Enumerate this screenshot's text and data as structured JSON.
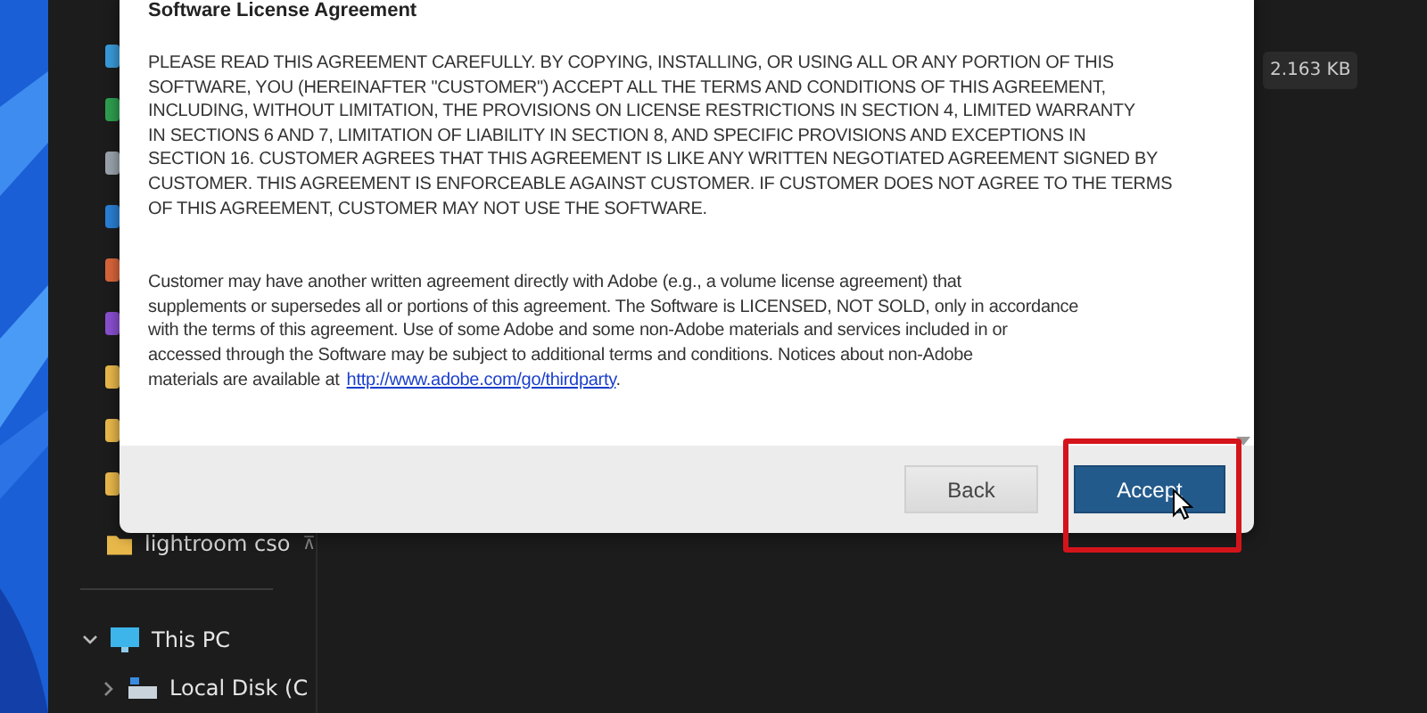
{
  "explorer": {
    "hidden_items": [
      {
        "color": "#3a9ad9"
      },
      {
        "color": "#2e9e4f"
      },
      {
        "color": "#9aa3ad"
      },
      {
        "color": "#2a7fd4"
      },
      {
        "color": "#d9653b"
      },
      {
        "color": "#8a4fd0"
      },
      {
        "color": "#e8b84a"
      },
      {
        "color": "#e8b84a"
      },
      {
        "color": "#e8b84a"
      }
    ],
    "folder": {
      "label": "lightroom cso",
      "pin": "⊼"
    },
    "tree": [
      {
        "label": "This PC",
        "expanded": true,
        "children": [
          {
            "label": "Local Disk (C",
            "expanded": false
          }
        ]
      }
    ],
    "tooltip": "2.163 KB"
  },
  "dialog": {
    "title": "Software License Agreement",
    "paragraphs": [
      {
        "lines": [
          "PLEASE READ THIS AGREEMENT CAREFULLY. BY COPYING, INSTALLING, OR USING ALL OR ANY PORTION OF THIS",
          "SOFTWARE, YOU (HEREINAFTER \"CUSTOMER\") ACCEPT ALL THE TERMS AND CONDITIONS OF THIS AGREEMENT,",
          "INCLUDING, WITHOUT LIMITATION, THE PROVISIONS ON LICENSE RESTRICTIONS IN SECTION 4, LIMITED WARRANTY",
          "IN SECTIONS 6 AND 7, LIMITATION OF LIABILITY IN SECTION 8, AND SPECIFIC PROVISIONS AND EXCEPTIONS IN",
          "SECTION 16. CUSTOMER AGREES THAT THIS AGREEMENT IS LIKE ANY WRITTEN NEGOTIATED AGREEMENT SIGNED BY",
          "CUSTOMER. THIS AGREEMENT IS ENFORCEABLE AGAINST CUSTOMER. IF CUSTOMER DOES NOT AGREE TO THE TERMS",
          "OF THIS AGREEMENT, CUSTOMER MAY NOT USE THE SOFTWARE."
        ]
      },
      {
        "lines": [
          "Customer may have another written agreement directly with Adobe (e.g., a volume license agreement) that",
          "supplements or supersedes all or portions of this agreement. The Software is LICENSED, NOT SOLD, only in accordance",
          "with the terms of this agreement. Use of some Adobe and some non-Adobe materials and services included in or",
          "accessed through the Software may be subject to additional terms and conditions. Notices about non-Adobe",
          "materials are available at"
        ],
        "link": "http://www.adobe.com/go/thirdparty",
        "tail": "."
      }
    ],
    "buttons": [
      {
        "label": "Back",
        "kind": "secondary",
        "highlighted": false
      },
      {
        "label": "Accept",
        "kind": "primary",
        "highlighted": true
      }
    ]
  }
}
